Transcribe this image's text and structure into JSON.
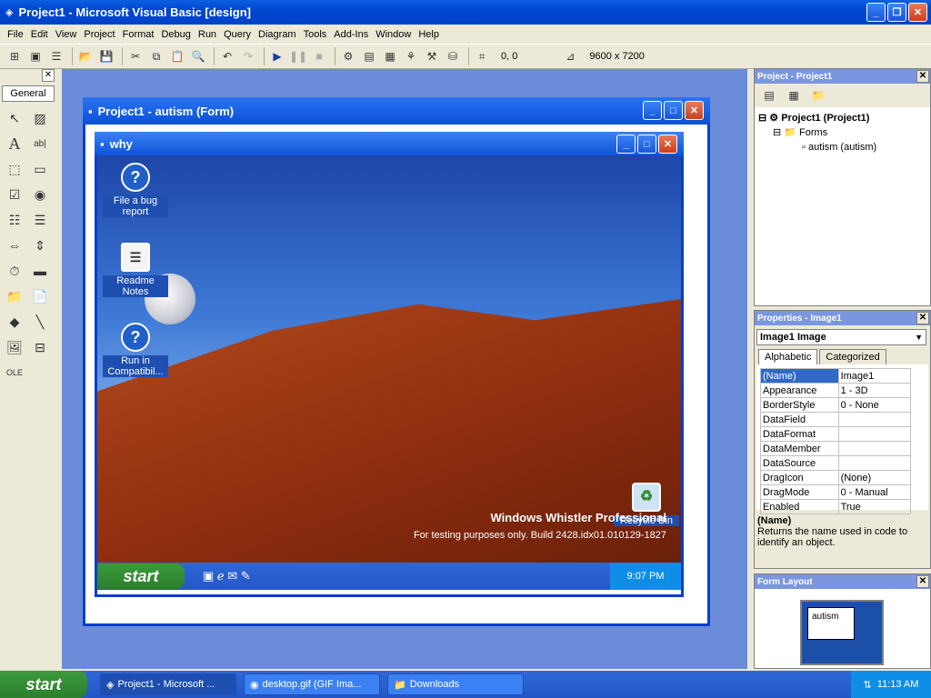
{
  "title": "Project1 - Microsoft Visual Basic [design]",
  "menu": [
    "File",
    "Edit",
    "View",
    "Project",
    "Format",
    "Debug",
    "Run",
    "Query",
    "Diagram",
    "Tools",
    "Add-Ins",
    "Window",
    "Help"
  ],
  "toolbar": {
    "position": "0, 0",
    "size": "9600 x 7200"
  },
  "toolbox": {
    "tab": "General"
  },
  "form": {
    "title": "Project1 - autism (Form)"
  },
  "image_window": {
    "title": "why",
    "icons": [
      "File a bug report",
      "Readme Notes",
      "Run in Compatibil...",
      "Recycle Bin"
    ],
    "watermark_title": "Windows Whistler Professional",
    "watermark_build": "For testing purposes only. Build 2428.idx01.010129-1827",
    "start": "start",
    "clock": "9:07 PM"
  },
  "project_panel": {
    "title": "Project - Project1",
    "root": "Project1 (Project1)",
    "folder": "Forms",
    "item": "autism (autism)"
  },
  "properties_panel": {
    "title": "Properties - Image1",
    "object": "Image1  Image",
    "tabs": [
      "Alphabetic",
      "Categorized"
    ],
    "rows": [
      [
        "(Name)",
        "Image1"
      ],
      [
        "Appearance",
        "1 - 3D"
      ],
      [
        "BorderStyle",
        "0 - None"
      ],
      [
        "DataField",
        ""
      ],
      [
        "DataFormat",
        ""
      ],
      [
        "DataMember",
        ""
      ],
      [
        "DataSource",
        ""
      ],
      [
        "DragIcon",
        "(None)"
      ],
      [
        "DragMode",
        "0 - Manual"
      ],
      [
        "Enabled",
        "True"
      ]
    ],
    "desc_title": "(Name)",
    "desc_text": "Returns the name used in code to identify an object."
  },
  "layout_panel": {
    "title": "Form Layout",
    "form": "autism"
  },
  "taskbar": {
    "start": "start",
    "tasks": [
      "Project1 - Microsoft ...",
      "desktop.gif (GIF Ima...",
      "Downloads"
    ],
    "clock": "11:13 AM"
  }
}
